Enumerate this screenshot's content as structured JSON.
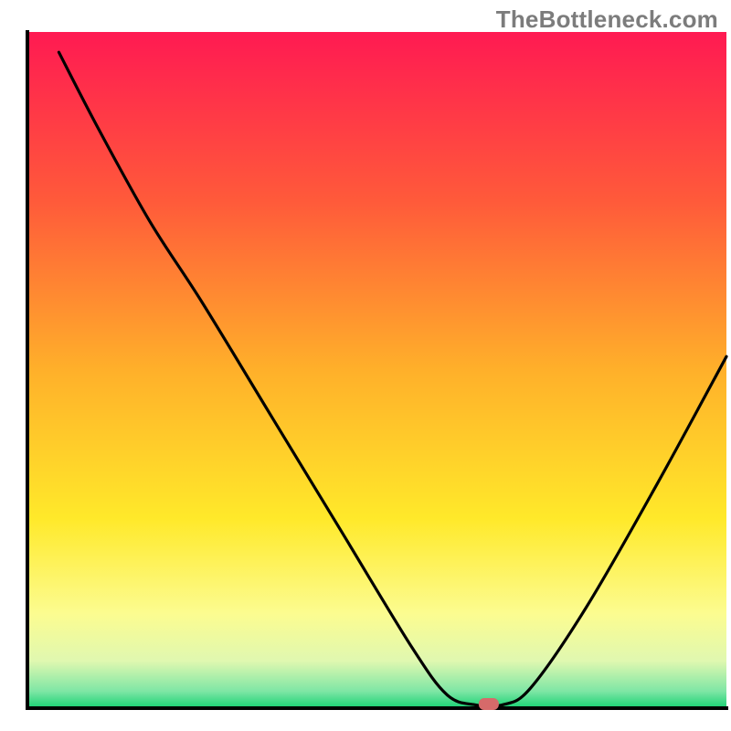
{
  "watermark": "TheBottleneck.com",
  "chart_data": {
    "type": "line",
    "title": "",
    "xlabel": "",
    "ylabel": "",
    "x_range": [
      0,
      100
    ],
    "y_range": [
      0,
      100
    ],
    "curve_description": "black V-shaped bottleneck curve over vertical gradient background",
    "curve_points": [
      {
        "x": 4.5,
        "y": 97.0
      },
      {
        "x": 10.0,
        "y": 86.0
      },
      {
        "x": 17.5,
        "y": 72.0
      },
      {
        "x": 25.0,
        "y": 60.0
      },
      {
        "x": 35.0,
        "y": 43.0
      },
      {
        "x": 45.0,
        "y": 26.0
      },
      {
        "x": 55.0,
        "y": 9.0
      },
      {
        "x": 60.0,
        "y": 2.0
      },
      {
        "x": 64.0,
        "y": 0.5
      },
      {
        "x": 68.0,
        "y": 0.5
      },
      {
        "x": 72.0,
        "y": 3.0
      },
      {
        "x": 80.0,
        "y": 15.0
      },
      {
        "x": 90.0,
        "y": 33.0
      },
      {
        "x": 100.0,
        "y": 52.0
      }
    ],
    "marker": {
      "x": 66.0,
      "y": 0.6,
      "color": "#d66a6a"
    },
    "background_gradient": {
      "stops": [
        {
          "offset": 0.0,
          "color": "#ff1a52"
        },
        {
          "offset": 0.25,
          "color": "#ff5a3a"
        },
        {
          "offset": 0.5,
          "color": "#ffb02a"
        },
        {
          "offset": 0.72,
          "color": "#ffe92a"
        },
        {
          "offset": 0.86,
          "color": "#fcfc90"
        },
        {
          "offset": 0.93,
          "color": "#e0f8b0"
        },
        {
          "offset": 0.975,
          "color": "#7ee6a5"
        },
        {
          "offset": 1.0,
          "color": "#18d173"
        }
      ]
    },
    "axes": {
      "color": "#000000",
      "width": 4
    }
  }
}
